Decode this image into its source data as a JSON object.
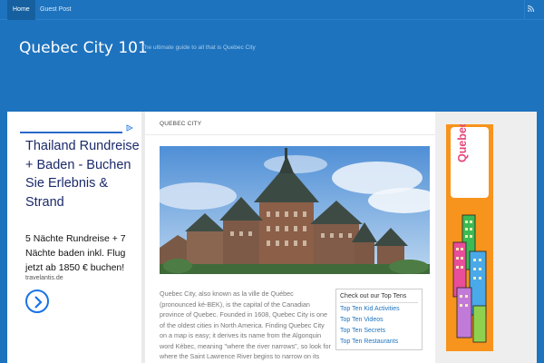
{
  "nav": {
    "items": [
      {
        "label": "Home",
        "active": true
      },
      {
        "label": "Guest Post",
        "active": false
      }
    ],
    "rss_icon": "rss-icon"
  },
  "header": {
    "title": "Quebec City 101",
    "description": "The ultimate guide to all that is Quebec City"
  },
  "left_ad": {
    "title": "Thailand Rundreise + Baden - Buchen Sie Erlebnis & Strand",
    "body": "5 Nächte Rundreise + 7 Nächte baden inkl. Flug jetzt ab 1850 € buchen!",
    "site": "travelantis.de",
    "choice_icon": "ad-choices-icon",
    "arrow_icon": "chevron-right-icon"
  },
  "main": {
    "category": "QUEBEC CITY",
    "article_text": "Quebec City, also known as la ville de Québec (pronounced ké-BEK), is the capital of the Canadian province of Quebec. Founded in 1608, Quebec City is one of the oldest cities in North America. Finding Quebec City on a map is easy; it derives its name from the Algonquin word Kébec, meaning \"where the river narrows\", so look for where the Saint Lawrence River begins to narrow on its way to the Great Lakes. The city of Lévis is across",
    "top_ten": {
      "heading": "Check out our Top Tens",
      "links": [
        "Top Ten Kid Activities",
        "Top Ten Videos",
        "Top Ten Secrets",
        "Top Ten Restaurants"
      ]
    }
  },
  "right_ad": {
    "logo_text": "QuebecCity Condo.com"
  },
  "colors": {
    "brand_blue": "#1e73be",
    "link_blue": "#1e73be",
    "condo_orange": "#f7941d"
  }
}
